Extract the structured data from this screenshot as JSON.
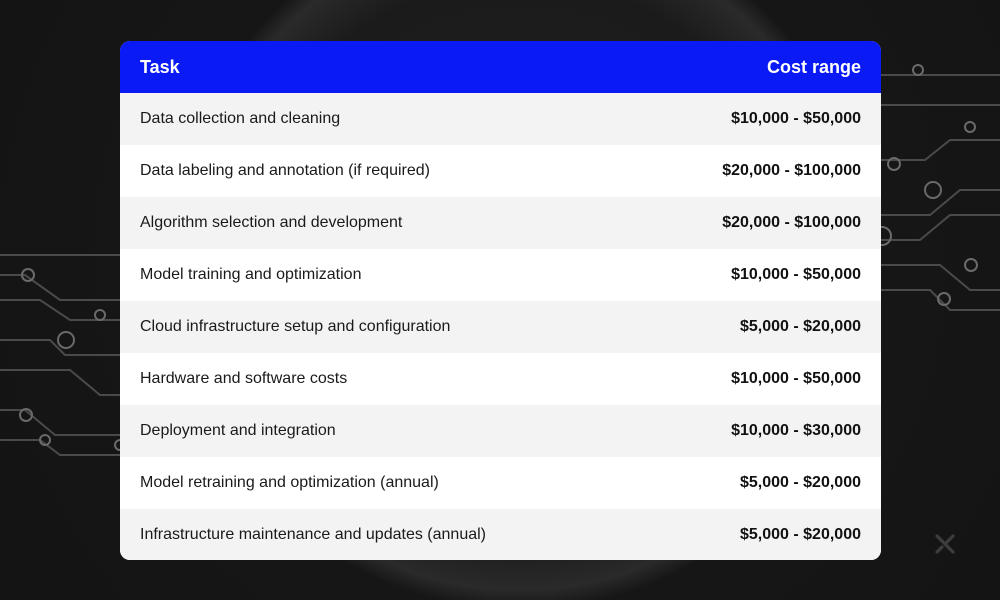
{
  "table": {
    "headers": {
      "task": "Task",
      "cost": "Cost range"
    },
    "rows": [
      {
        "task": "Data collection and cleaning",
        "cost": "$10,000 - $50,000"
      },
      {
        "task": "Data labeling and annotation (if required)",
        "cost": "$20,000 - $100,000"
      },
      {
        "task": "Algorithm selection and development",
        "cost": "$20,000 - $100,000"
      },
      {
        "task": "Model training and optimization",
        "cost": "$10,000 - $50,000"
      },
      {
        "task": "Cloud infrastructure setup and configuration",
        "cost": "$5,000 - $20,000"
      },
      {
        "task": "Hardware and software costs",
        "cost": "$10,000 - $50,000"
      },
      {
        "task": "Deployment and integration",
        "cost": "$10,000 - $30,000"
      },
      {
        "task": "Model retraining and optimization (annual)",
        "cost": "$5,000 - $20,000"
      },
      {
        "task": "Infrastructure maintenance and updates (annual)",
        "cost": "$5,000 - $20,000"
      }
    ]
  },
  "colors": {
    "header_bg": "#0a1af5",
    "background": "#151515",
    "row_alt": "#f3f3f3"
  },
  "brand": {
    "logo_icon": "x-logo-icon"
  }
}
